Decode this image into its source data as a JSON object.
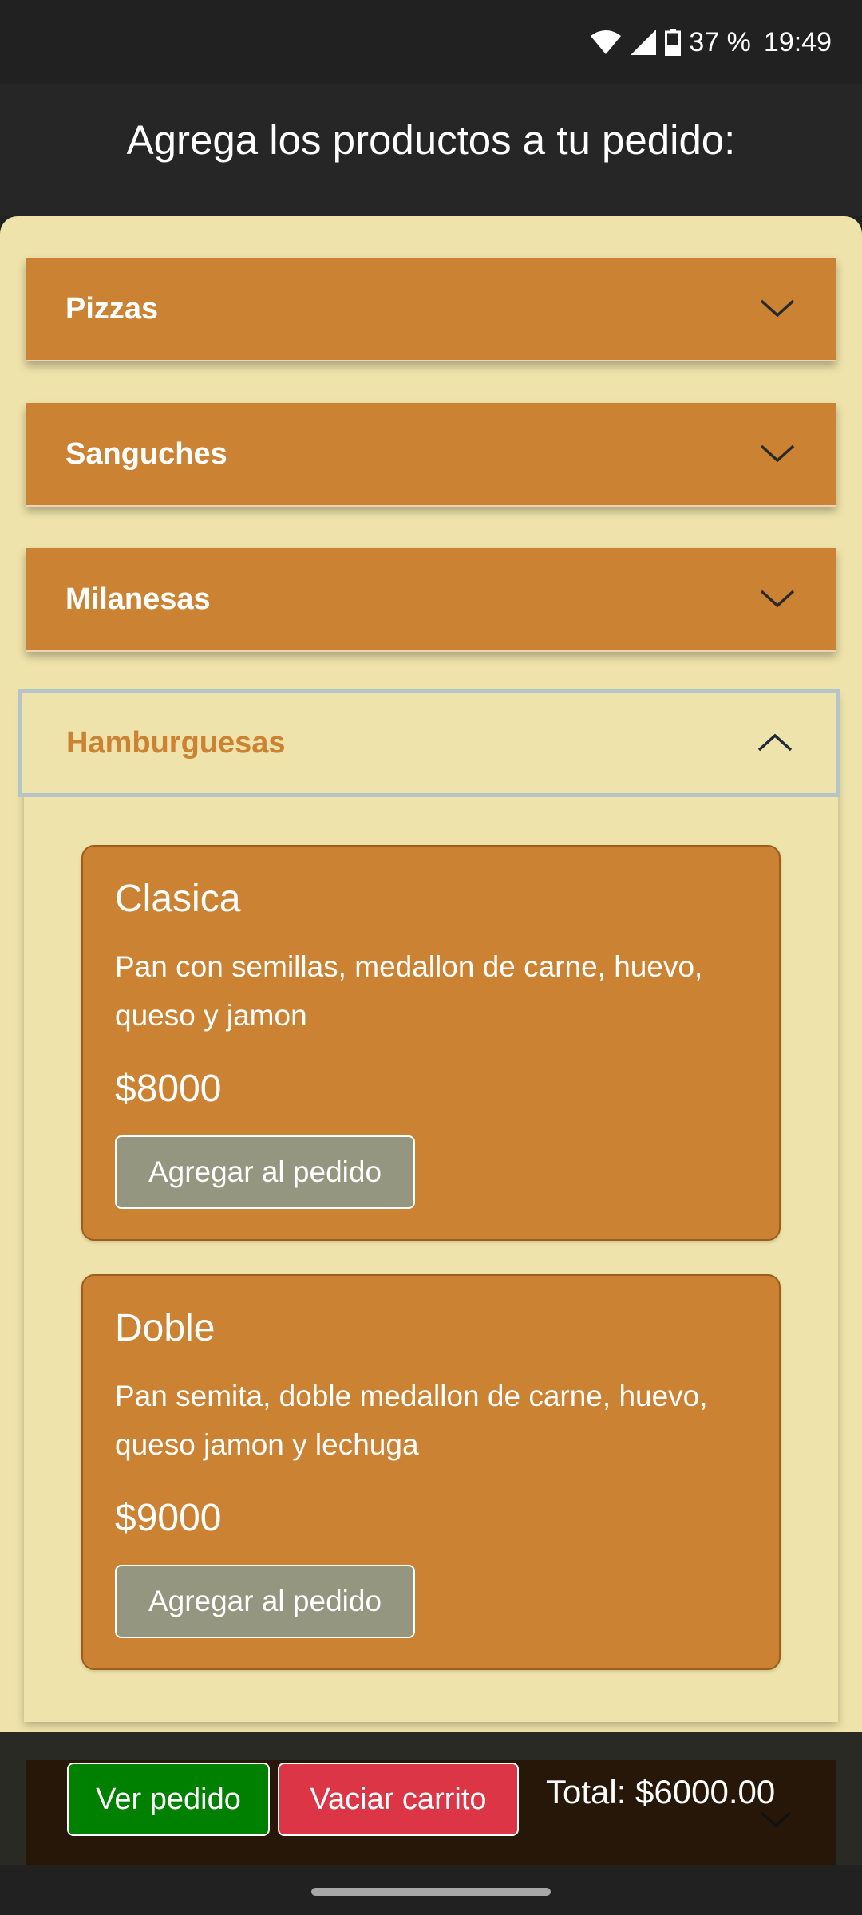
{
  "status_bar": {
    "battery_percent": "37 %",
    "time": "19:49",
    "icons": [
      "wifi-icon",
      "signal-icon",
      "battery-icon"
    ]
  },
  "header": {
    "title": "Agrega los productos a tu pedido:"
  },
  "categories": [
    {
      "label": "Pizzas",
      "expanded": false
    },
    {
      "label": "Sanguches",
      "expanded": false
    },
    {
      "label": "Milanesas",
      "expanded": false
    },
    {
      "label": "Hamburguesas",
      "expanded": true
    }
  ],
  "products": [
    {
      "name": "Clasica",
      "description": "Pan con semillas, medallon de carne, huevo, queso y jamon",
      "price": "$8000",
      "button_label": "Agregar al pedido"
    },
    {
      "name": "Doble",
      "description": "Pan semita, doble medallon de carne, huevo, queso jamon y lechuga",
      "price": "$9000",
      "button_label": "Agregar al pedido"
    }
  ],
  "footer": {
    "view_order_label": "Ver pedido",
    "empty_cart_label": "Vaciar carrito",
    "total_text": "Total: $6000.00"
  },
  "colors": {
    "accent": "#cb8333",
    "background": "#eee3aa",
    "success": "#008000",
    "danger": "#dc3545",
    "add_button": "#949680"
  }
}
